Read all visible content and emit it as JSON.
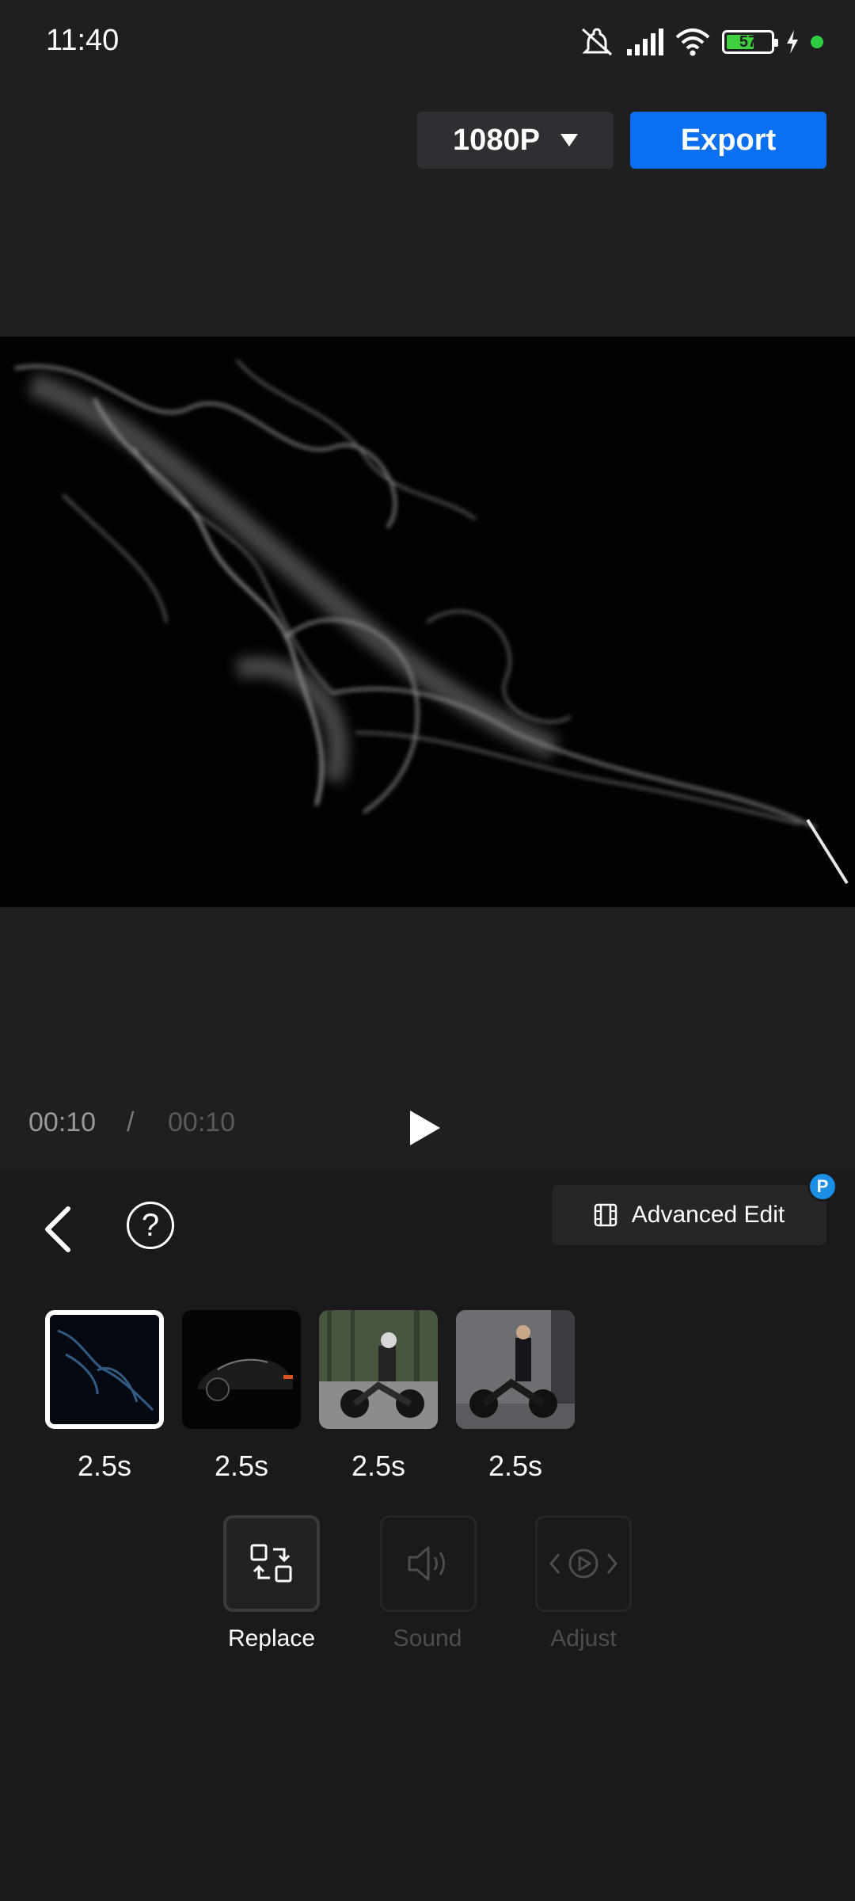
{
  "status_bar": {
    "time": "11:40",
    "battery_level": "57",
    "icons": [
      "mute-icon",
      "signal-icon",
      "wifi-icon",
      "battery-icon",
      "charging-icon",
      "status-dot"
    ]
  },
  "toolbar": {
    "resolution_label": "1080P",
    "export_label": "Export"
  },
  "playback": {
    "current_time": "00:10",
    "separator": "/",
    "total_time": "00:10"
  },
  "panel": {
    "advanced_edit_label": "Advanced Edit",
    "pro_badge": "P",
    "help_symbol": "?",
    "clips": [
      {
        "duration": "2.5s",
        "selected": true
      },
      {
        "duration": "2.5s",
        "selected": false
      },
      {
        "duration": "2.5s",
        "selected": false
      },
      {
        "duration": "2.5s",
        "selected": false
      }
    ],
    "tools": [
      {
        "label": "Replace",
        "enabled": true
      },
      {
        "label": "Sound",
        "enabled": false
      },
      {
        "label": "Adjust",
        "enabled": false
      }
    ]
  },
  "colors": {
    "accent": "#0a6ff0",
    "background": "#1f1f21",
    "panel": "#1a1a1c",
    "disabled_text": "#4d4d50"
  }
}
